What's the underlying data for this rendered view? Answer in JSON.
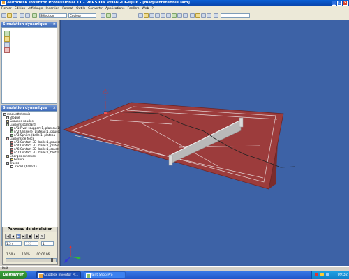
{
  "window": {
    "title": "Autodesk Inventor Professional 11 - VERSION PEDAGOGIQUE - [maquettetennis.iam]",
    "buttons": {
      "minimize": "_",
      "maximize": "□",
      "close": "×"
    }
  },
  "menu": [
    "Fichier",
    "Edition",
    "Affichage",
    "Insertion",
    "Format",
    "Outils",
    "Convertir",
    "Applications",
    "Fenêtre",
    "Web",
    "?"
  ],
  "toolbar": {
    "combo1": "Sélection",
    "combo2": "Couleur"
  },
  "panel_top": {
    "title": "Simulation dynamique"
  },
  "panel_browser": {
    "title": "Simulation dynamique",
    "items": [
      {
        "label": "maquettetennis",
        "level": 0,
        "icon": "assembly-icon"
      },
      {
        "label": "Bloqué",
        "level": 1,
        "icon": "lock-icon"
      },
      {
        "label": "Groupes soudés",
        "level": 1,
        "icon": "group-icon"
      },
      {
        "label": "Liaisons standard",
        "level": 1,
        "icon": "link-icon"
      },
      {
        "label": "n°1:Pivot (support:1, plateau:1)",
        "level": 2,
        "icon": "joint-icon"
      },
      {
        "label": "n°2:Glissière (plateau:1, poussoi",
        "level": 2,
        "icon": "joint-icon"
      },
      {
        "label": "n°3:Sphère (balle:1, plateau",
        "level": 2,
        "icon": "joint-icon"
      },
      {
        "label": "Liaisons de force",
        "level": 1,
        "icon": "force-icon"
      },
      {
        "label": "n°3:Contact 3D (balle:1, pousse",
        "level": 2,
        "icon": "contact-icon"
      },
      {
        "label": "n°4:Contact 3D (balle:1, platea",
        "level": 2,
        "icon": "contact-icon"
      },
      {
        "label": "n°6:Contact 3D (balle:1, court:",
        "level": 2,
        "icon": "contact-icon"
      },
      {
        "label": "n°7:Contact 3D (balle:1, filet:1",
        "level": 2,
        "icon": "contact-icon"
      },
      {
        "label": "Charges externes",
        "level": 1,
        "icon": "load-icon"
      },
      {
        "label": "Gravité",
        "level": 2,
        "icon": "gravity-icon"
      },
      {
        "label": "Traces",
        "level": 1,
        "icon": "trace-icon"
      },
      {
        "label": "Trace1 (balle:1)",
        "level": 2,
        "icon": "trace-icon"
      }
    ]
  },
  "sim_panel": {
    "title": "Panneau de simulation",
    "final_time": "1.5 s",
    "images": "150",
    "filter": "1",
    "current_time": "1.50 s",
    "percent": "100%",
    "steps": "00:00.06"
  },
  "status_bar": "Prêt",
  "taskbar": {
    "start": "Démarrer",
    "tasks": [
      "Autodesk Inventor Pr...",
      "Paint Shop Pro"
    ],
    "clock": "09:32"
  },
  "colors": {
    "viewport": "#3d62a6",
    "court": "#9c3c3c",
    "court_border": "#7a2c2c",
    "title_bar": "#0a5fd6"
  }
}
